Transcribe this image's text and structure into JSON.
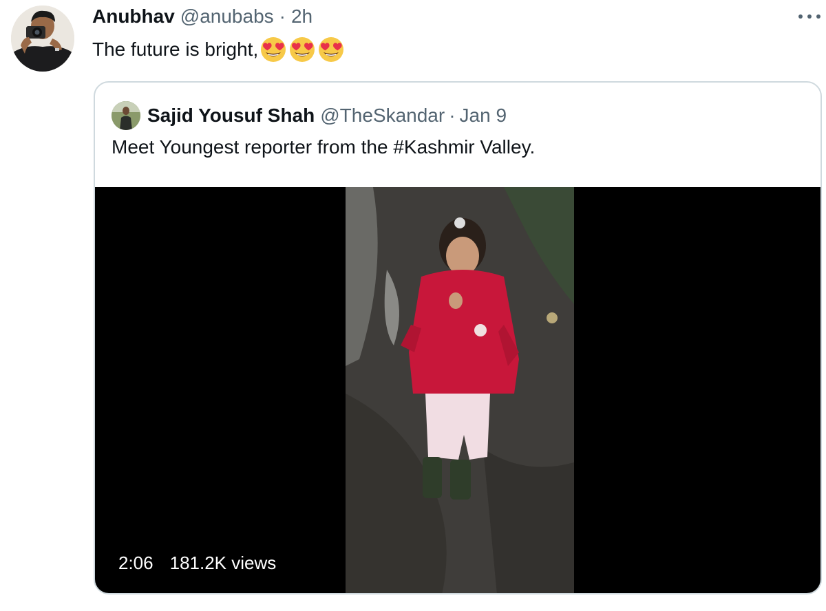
{
  "tweet": {
    "author": {
      "name": "Anubhav",
      "handle": "@anubabs",
      "separator": "·",
      "time": "2h"
    },
    "text": "The future is bright,",
    "emojis": [
      "heart-eyes-emoji",
      "heart-eyes-emoji",
      "heart-eyes-emoji"
    ]
  },
  "quoted": {
    "author": {
      "name": "Sajid Yousuf Shah",
      "handle": "@TheSkandar",
      "separator": "·",
      "time": "Jan 9"
    },
    "text": "Meet Youngest reporter from the #Kashmir Valley.",
    "video": {
      "duration": "2:06",
      "views": "181.2K views"
    }
  },
  "icons": {
    "more": "more-horizontal-icon"
  },
  "colors": {
    "text_primary": "#0f1419",
    "text_secondary": "#536471",
    "border": "#cfd9de",
    "video_bg": "#000000"
  }
}
